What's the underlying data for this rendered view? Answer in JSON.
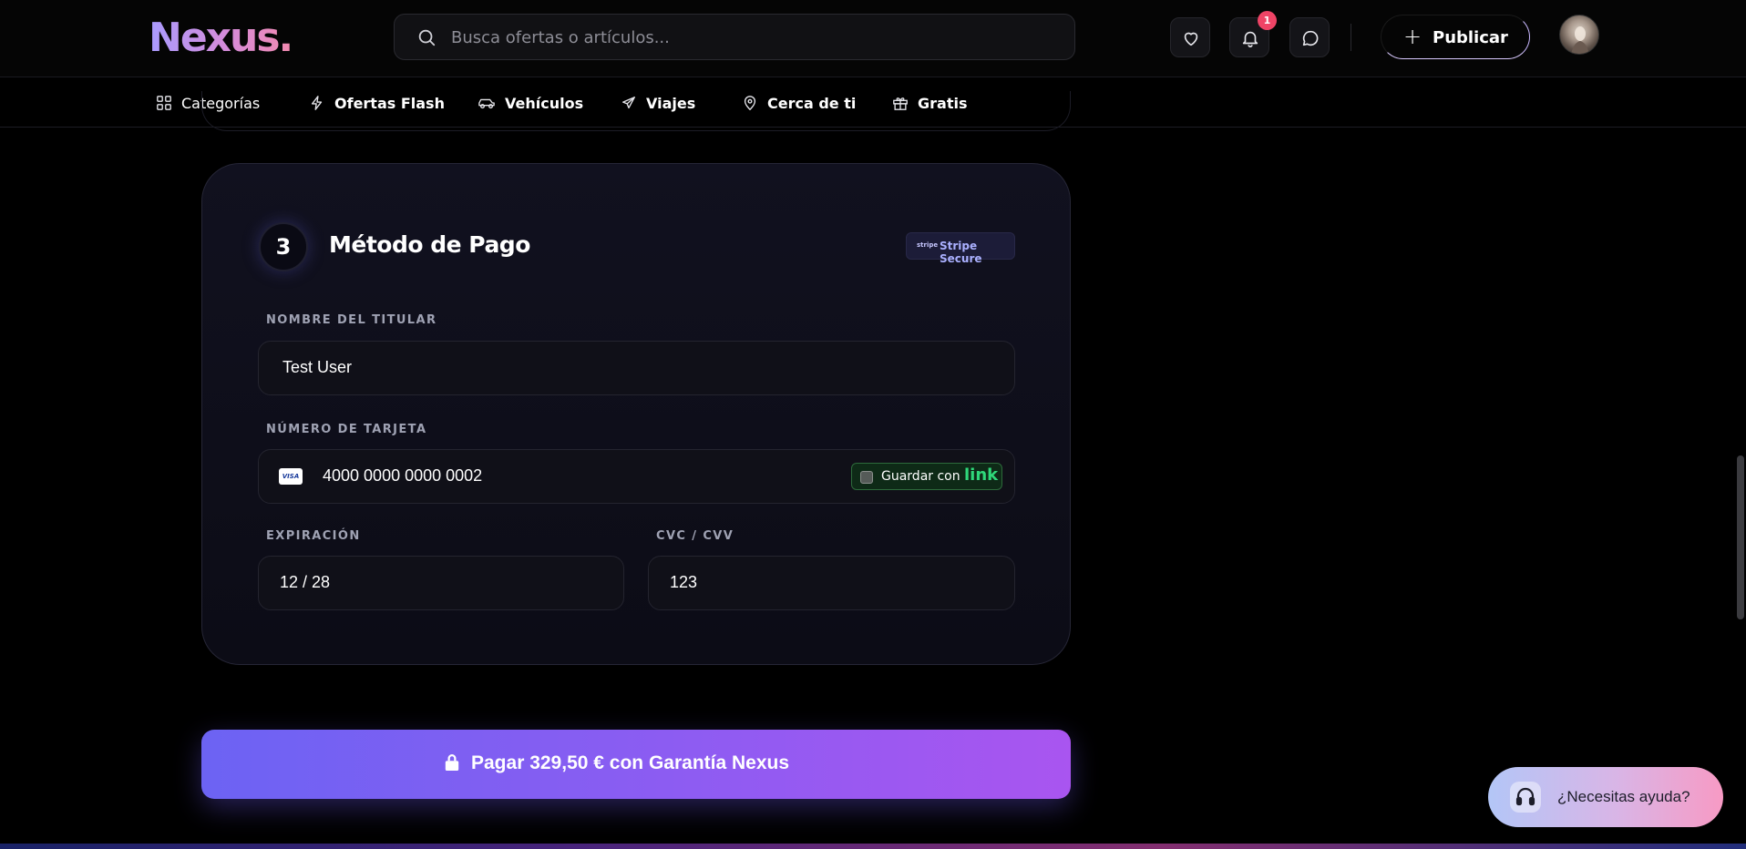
{
  "brand": {
    "logo": "Nexus."
  },
  "search": {
    "placeholder": "Busca ofertas o artículos..."
  },
  "header": {
    "notification_count": "1",
    "publish_label": "Publicar"
  },
  "nav": {
    "items": [
      {
        "label": "Categorías",
        "icon": "grid-icon"
      },
      {
        "label": "Ofertas Flash",
        "icon": "lightning-icon"
      },
      {
        "label": "Vehículos",
        "icon": "car-icon"
      },
      {
        "label": "Viajes",
        "icon": "plane-icon"
      },
      {
        "label": "Cerca de ti",
        "icon": "map-pin-icon"
      },
      {
        "label": "Gratis",
        "icon": "gift-icon"
      }
    ]
  },
  "payment": {
    "step_number": "3",
    "title": "Método de Pago",
    "secure_badge": "Stripe Secure",
    "stripe_mark": "stripe",
    "holder_label": "NOMBRE DEL TITULAR",
    "holder_value": "Test User",
    "card_label": "NÚMERO DE TARJETA",
    "card_value": "4000 0000 0000 0002",
    "card_brand": "VISA",
    "save_with": "Guardar con",
    "link_brand": "link",
    "expiry_label": "EXPIRACIÓN",
    "expiry_value": "12 / 28",
    "cvc_label": "CVC / CVV",
    "cvc_value": "123"
  },
  "pay_button": {
    "label": "Pagar 329,50 € con Garantía Nexus"
  },
  "help": {
    "label": "¿Necesitas ayuda?"
  },
  "colors": {
    "accent_start": "#6c63f3",
    "accent_end": "#a955f0",
    "badge": "#ef4466",
    "link_green": "#2fd87a"
  }
}
